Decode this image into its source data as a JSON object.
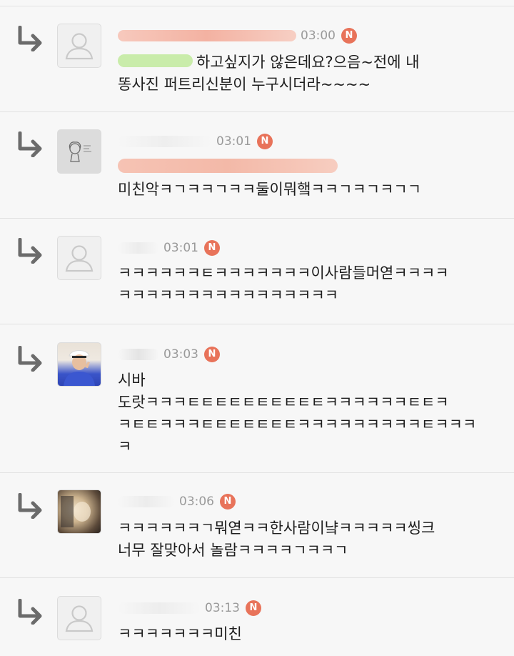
{
  "comments": [
    {
      "time": "03:00",
      "badge": "N",
      "avatar": "default-avatar",
      "text": "하고싶지가 않은데요?으음~전에 내\n똥사진 퍼트리신분이 누구시더라~~~~"
    },
    {
      "time": "03:01",
      "badge": "N",
      "avatar": "sketch-avatar",
      "text": "미친악ㅋㄱㅋㅋㄱㅋㅋ둘이뭐햌ㅋㅋㄱㅋㄱㅋㄱㄱ"
    },
    {
      "time": "03:01",
      "badge": "N",
      "avatar": "default-avatar",
      "text": "ㅋㅋㅋㅋㅋㅋㅌㅋㅋㅋㅋㅋㅋㅋ이사람들머엳ㅋㅋㅋㅋ\nㅋㅋㅋㅋㅋㅋㅋㅋㅋㅋㅋㅋㅋㅋㅋㅋ"
    },
    {
      "time": "03:03",
      "badge": "N",
      "avatar": "photo-avatar",
      "text": "시바\n도랏ㅋㅋㅋㅌㅌㅌㅌㅌㅌㅌㅌㅌㅌㅋㅋㅋㅋㅋㅋㅌㅌㅋ\nㅋㅌㅌㅋㅋㅋㅌㅌㅌㅌㅌㅌㅌㅋㅋㅋㅋㅋㅋㅋㅋㅋㅌㅋㅋㅋ\nㅋ"
    },
    {
      "time": "03:06",
      "badge": "N",
      "avatar": "photo-avatar",
      "text": "ㅋㅋㅋㅋㅋㅋㄱ뭐엳ㅋㅋ한사람이냨ㅋㅋㅋㅋㅋ씽크\n너무 잘맞아서 놀람ㅋㅋㅋㅋㄱㅋㅋㄱ"
    },
    {
      "time": "03:13",
      "badge": "N",
      "avatar": "default-avatar",
      "text": "ㅋㅋㅋㅋㅋㅋㅋ미친"
    }
  ],
  "colors": {
    "badge": "#e8735a",
    "time": "#9a9a9a",
    "divider": "#e2e2e2",
    "background": "#f7f7f7"
  }
}
